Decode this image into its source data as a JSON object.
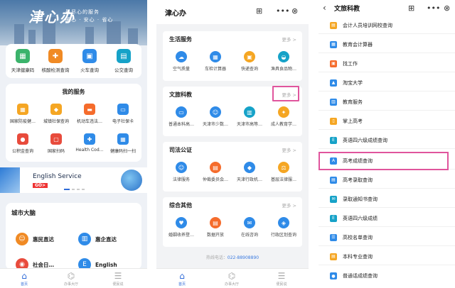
{
  "screen1": {
    "hero": {
      "logo": "津心办",
      "slogan_line1": "最尽心的服务",
      "slogan_line2": "暖心 · 安心 · 省心"
    },
    "quick": [
      {
        "label": "天津健康码",
        "icon": "health-code-icon",
        "color": "#3bb36b"
      },
      {
        "label": "核酸检测查询",
        "icon": "test-tube-icon",
        "color": "#f08a24"
      },
      {
        "label": "火车查询",
        "icon": "train-icon",
        "color": "#2f8be8"
      },
      {
        "label": "公交查询",
        "icon": "bus-icon",
        "color": "#16a2c8"
      }
    ],
    "services_title": "我的服务",
    "services": [
      {
        "label": "国家防疫健…",
        "icon": "grid-icon",
        "color": "#f5a623"
      },
      {
        "label": "城镇社保查询",
        "icon": "shield-icon",
        "color": "#f5a623"
      },
      {
        "label": "机动车违法…",
        "icon": "car-icon",
        "color": "#f56c2c"
      },
      {
        "label": "电子社保卡",
        "icon": "card-icon",
        "color": "#2f8be8"
      },
      {
        "label": "公积金查询",
        "icon": "coin-icon",
        "color": "#e84b3c"
      },
      {
        "label": "国家扫码",
        "icon": "scan-icon",
        "color": "#e84b3c"
      },
      {
        "label": "Health Cod…",
        "icon": "health-icon",
        "color": "#2f8be8"
      },
      {
        "label": "健康码扫一扫",
        "icon": "qr-icon",
        "color": "#2f8be8"
      }
    ],
    "banner": {
      "text": "English  Service",
      "go": "GO>"
    },
    "city": {
      "title": "城市大脑",
      "items": [
        {
          "label": "惠民直达",
          "icon": "people-icon",
          "color": "#f08a24"
        },
        {
          "label": "惠企直达",
          "icon": "building-icon",
          "color": "#2f8be8"
        },
        {
          "label": "社会日…",
          "icon": "globe-icon",
          "color": "#e84b3c"
        },
        {
          "label": "English",
          "icon": "english-icon",
          "color": "#2f8be8"
        }
      ]
    },
    "tabs": [
      {
        "label": "首页",
        "icon": "home-icon",
        "active": true
      },
      {
        "label": "办事大厅",
        "icon": "hall-icon",
        "active": false
      },
      {
        "label": "便民说",
        "icon": "list-icon",
        "active": false
      }
    ]
  },
  "screen2": {
    "title": "津心办",
    "sections": [
      {
        "title": "生活服务",
        "more": "更多 >",
        "items": [
          {
            "label": "空气质量",
            "icon": "cloud-icon",
            "color": "#2f8be8"
          },
          {
            "label": "车检计算器",
            "icon": "calculator-icon",
            "color": "#2f8be8"
          },
          {
            "label": "快递查询",
            "icon": "box-icon",
            "color": "#f5a623"
          },
          {
            "label": "渔具食品物…",
            "icon": "food-icon",
            "color": "#16a2c8"
          }
        ]
      },
      {
        "title": "文旅科教",
        "more": "更多 >",
        "highlight": true,
        "items": [
          {
            "label": "普通本科高…",
            "icon": "monitor-icon",
            "color": "#2f8be8"
          },
          {
            "label": "天津市少数…",
            "icon": "people-icon",
            "color": "#2f8be8"
          },
          {
            "label": "天津市高等…",
            "icon": "school-icon",
            "color": "#16a2c8"
          },
          {
            "label": "成人教育学…",
            "icon": "lightbulb-icon",
            "color": "#f5a623"
          }
        ]
      },
      {
        "title": "司法公证",
        "more": "更多 >",
        "items": [
          {
            "label": "法律服务",
            "icon": "lawyer-icon",
            "color": "#2f8be8"
          },
          {
            "label": "仲裁委员会…",
            "icon": "document-icon",
            "color": "#f56c2c"
          },
          {
            "label": "天津行政机…",
            "icon": "institution-icon",
            "color": "#2f8be8"
          },
          {
            "label": "基层法律服…",
            "icon": "scale-icon",
            "color": "#f5a623"
          }
        ]
      },
      {
        "title": "综合其他",
        "more": "更多 >",
        "items": [
          {
            "label": "婚姻收养登…",
            "icon": "marriage-icon",
            "color": "#2f8be8"
          },
          {
            "label": "数据开放",
            "icon": "data-icon",
            "color": "#f56c2c"
          },
          {
            "label": "在线咨询",
            "icon": "chat-icon",
            "color": "#2f8be8"
          },
          {
            "label": "行政区划查询",
            "icon": "map-icon",
            "color": "#2f8be8"
          }
        ]
      }
    ],
    "hotline_label": "热线电话：",
    "hotline": "022-88908890",
    "tabs": [
      {
        "label": "首页",
        "icon": "home-icon",
        "active": true
      },
      {
        "label": "办事大厅",
        "icon": "hall-icon",
        "active": false
      },
      {
        "label": "便民说",
        "icon": "list-icon",
        "active": false
      }
    ]
  },
  "screen3": {
    "title": "文旅科教",
    "items": [
      {
        "label": "会计人员培训网校查询",
        "icon": "book-icon",
        "color": "#f5a623"
      },
      {
        "label": "教育会计算器",
        "icon": "calculator-icon",
        "color": "#2f8be8"
      },
      {
        "label": "找工作",
        "icon": "briefcase-icon",
        "color": "#f56c2c"
      },
      {
        "label": "淘宝大学",
        "icon": "graduation-icon",
        "color": "#2f8be8"
      },
      {
        "label": "教育服务",
        "icon": "school-icon",
        "color": "#2f8be8"
      },
      {
        "label": "掌上高考",
        "icon": "phone-icon",
        "color": "#f5a623"
      },
      {
        "label": "英语四六级成绩查询",
        "icon": "english-icon",
        "color": "#16a2c8"
      },
      {
        "label": "高考成绩查询",
        "icon": "score-icon",
        "color": "#2f8be8",
        "highlight": true
      },
      {
        "label": "高考录取查询",
        "icon": "admission-icon",
        "color": "#2f8be8"
      },
      {
        "label": "录取通知书查询",
        "icon": "letter-icon",
        "color": "#16a2c8"
      },
      {
        "label": "英语四六级成绩",
        "icon": "english-icon",
        "color": "#16a2c8"
      },
      {
        "label": "高校名单查询",
        "icon": "list-icon",
        "color": "#2f8be8"
      },
      {
        "label": "本科专业查询",
        "icon": "book-icon",
        "color": "#f5a623"
      },
      {
        "label": "普通话成绩查询",
        "icon": "mic-icon",
        "color": "#2f8be8"
      }
    ]
  }
}
